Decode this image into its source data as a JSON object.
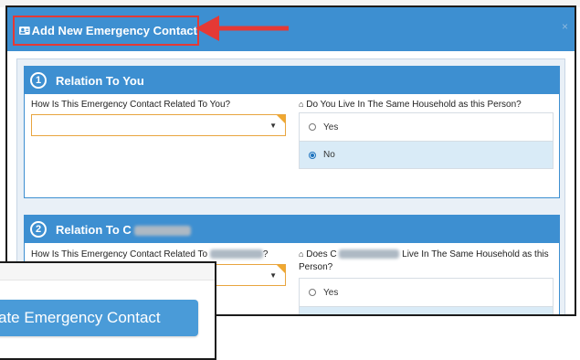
{
  "modal": {
    "title": "Add New Emergency Contact",
    "close_glyph": "×"
  },
  "section1": {
    "step": "1",
    "title": "Relation To You",
    "relation_label": "How Is This Emergency Contact Related To You?",
    "relation_value": "",
    "household_label": "Do You Live In The Same Household as this Person?",
    "options": [
      {
        "label": "Yes",
        "selected": false
      },
      {
        "label": "No",
        "selected": true
      }
    ]
  },
  "section2": {
    "step": "2",
    "title_prefix": "Relation To C",
    "relation_label_prefix": "How Is This Emergency Contact Related To",
    "relation_label_suffix": "?",
    "household_prefix": "Does C",
    "household_suffix": "Live In The Same Household as this",
    "household_line2": "Person?",
    "options": [
      {
        "label": "Yes",
        "selected": false
      }
    ]
  },
  "zoom": {
    "button_label": "ate Emergency Contact"
  },
  "icons": {
    "title": "contact-card-icon",
    "home": "home-icon",
    "caret": "caret-down-icon",
    "annotation": "red-arrow"
  },
  "colors": {
    "header_blue": "#3d8fd1",
    "highlight_red": "#e53935",
    "select_border": "#e8a53f",
    "selected_row": "#d9ebf7",
    "button_blue": "#4a9bd8"
  }
}
